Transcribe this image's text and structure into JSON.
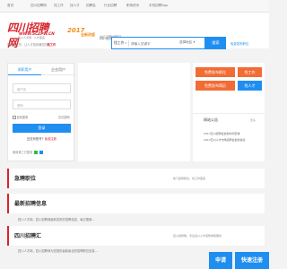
{
  "topnav": [
    "首页",
    "四川招聘网",
    "找工作",
    "找人才",
    "招聘会",
    "行业招聘",
    "职场资讯",
    "手机招聘App"
  ],
  "logo": {
    "title": "四川招聘网",
    "en": "WWW.SCZPW.CN",
    "sub": "四川人才网 · 人才首选"
  },
  "year": "2017",
  "year_sub": "全新改版",
  "slogan": "免费找工作，让人才找到满意的",
  "slogan_em": "新工作",
  "city": {
    "name": "四川招聘网",
    "switch": "[切换]",
    "hint": "人才·招聘·求职网"
  },
  "search": {
    "type": "找工作",
    "placeholder": "请输入关键字",
    "area": "选择地区",
    "button": "搜索"
  },
  "publish_link": "免费发布职位",
  "login": {
    "tab_personal": "求职用户",
    "tab_company": "企业用户",
    "username_placeholder": "用户名",
    "password_placeholder": "密码",
    "remember": "自动登录",
    "forgot": "忘记密码",
    "button": "登录",
    "register_text": "还没有账号？",
    "register_link": "免费注册",
    "qr_text": "使用第三方登录"
  },
  "side": {
    "btn_post_job": "免费发布职位",
    "btn_find_job": "找工作",
    "btn_post_resume": "免费发布简历",
    "btn_find_talent": "找人才"
  },
  "notice": {
    "title": "网站公告",
    "more": "更多",
    "lines": [
      "2017四川招聘会最新时间安排",
      "2017四川人才市场招聘会最新信息"
    ]
  },
  "sections": {
    "s1_title": "急聘职位",
    "s1_meta": "热门招聘职位，找工作首选",
    "s2_title": "最新招聘信息",
    "s2_row": "四川人才网，四川招聘网最新发布的招聘信息，每日更新...",
    "s3_title": "四川招聘汇",
    "s3_meta": "四川招聘网，专注四川人才招聘求职服务",
    "s3_row": "四川人才网，四川招聘网为您提供最新最全的招聘职位信息..."
  },
  "bottom": {
    "apply": "申请",
    "register": "快速注册"
  }
}
